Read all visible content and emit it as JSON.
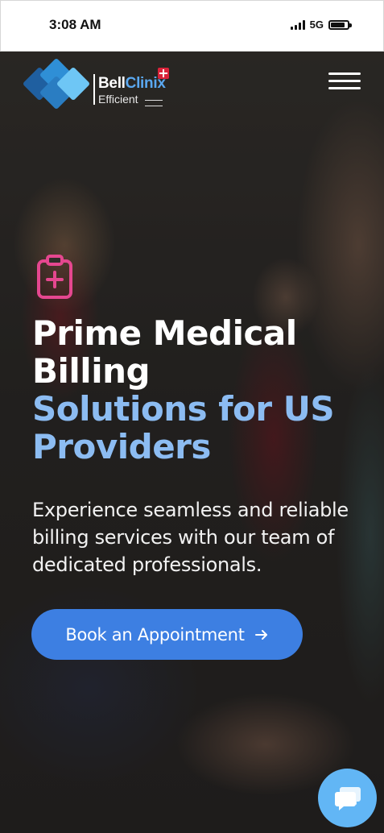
{
  "status_bar": {
    "time": "3:08 AM",
    "network": "5G",
    "battery_level": 0.76
  },
  "header": {
    "logo": {
      "brand_part1": "Bell",
      "brand_part2": "Clinix",
      "tagline": "Efficient"
    },
    "menu_icon": "hamburger-menu-icon"
  },
  "hero": {
    "icon": "clipboard-plus-icon",
    "title_line1": "Prime Medical",
    "title_line2": "Billing",
    "title_line3": "Solutions for US",
    "title_line4": "Providers",
    "description": "Experience seamless and reliable billing services with our team of dedicated professionals.",
    "cta_label": "Book an Appointment",
    "cta_icon": "arrow-right-icon"
  },
  "chat_widget": {
    "icon": "chat-bubble-icon"
  },
  "colors": {
    "accent_blue": "#3d7fe2",
    "title_blue": "#8cbcf2",
    "icon_pink": "#e5478f",
    "chat_blue": "#62b6f5",
    "brand_red": "#d9233a"
  }
}
